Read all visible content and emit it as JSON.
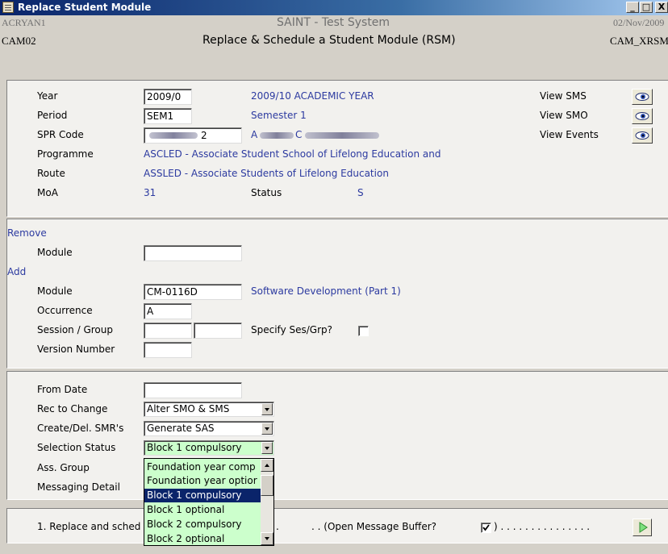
{
  "window": {
    "title": "Replace Student Module",
    "min_label": "_",
    "max_label": "□",
    "close_label": "X"
  },
  "header": {
    "user": "ACRYAN1",
    "system": "SAINT - Test System",
    "date": "02/Nov/2009",
    "screen_code": "CAM02",
    "screen_title": "Replace & Schedule a Student Module (RSM)",
    "screen_id": "CAM_XRSM"
  },
  "student": {
    "year_label": "Year",
    "year_value": "2009/0",
    "year_desc": "2009/10 ACADEMIC YEAR",
    "period_label": "Period",
    "period_value": "SEM1",
    "period_desc": "Semester 1",
    "spr_label": "SPR Code",
    "spr_value_suffix": "2",
    "spr_desc_a": "A",
    "spr_desc_c": "C",
    "programme_label": "Programme",
    "programme_value": "ASCLED - Associate Student School of Lifelong Education and",
    "route_label": "Route",
    "route_value": "ASSLED - Associate Students of Lifelong Education",
    "moa_label": "MoA",
    "moa_value": "31",
    "status_label": "Status",
    "status_value": "S",
    "view_sms": "View SMS",
    "view_smo": "View SMO",
    "view_events": "View Events"
  },
  "remove": {
    "section_label": "Remove",
    "module_label": "Module",
    "module_value": ""
  },
  "add": {
    "section_label": "Add",
    "module_label": "Module",
    "module_value": "CM-0116D",
    "module_desc": "Software Development (Part 1)",
    "occurrence_label": "Occurrence",
    "occurrence_value": "A",
    "session_label": "Session / Group",
    "specify_label": "Specify Ses/Grp?",
    "version_label": "Version Number"
  },
  "options": {
    "from_date_label": "From Date",
    "rec_label": "Rec to Change",
    "rec_value": "Alter SMO & SMS",
    "create_label": "Create/Del. SMR's",
    "create_value": "Generate SAS",
    "selection_label": "Selection Status",
    "selection_value": "Block 1 compulsory",
    "ass_group_label": "Ass. Group",
    "messaging_label": "Messaging Detail"
  },
  "dropdown": {
    "options": [
      "Foundation year comp",
      "Foundation year optior",
      "Block 1 compulsory",
      "Block 1 optional",
      "Block 2 compulsory",
      "Block 2 optional"
    ],
    "selected_index": 2
  },
  "footer": {
    "action_text": "1. Replace and sched",
    "action_text_tail": ".",
    "message_buffer": ". . (Open Message Buffer?",
    "message_checked": true,
    "dots": ") . . . . . . . . . . . . . . ."
  },
  "colors": {
    "accent_blue": "#2c3aa0",
    "list_bg": "#ccffcc",
    "selected_bg": "#0a246a"
  }
}
